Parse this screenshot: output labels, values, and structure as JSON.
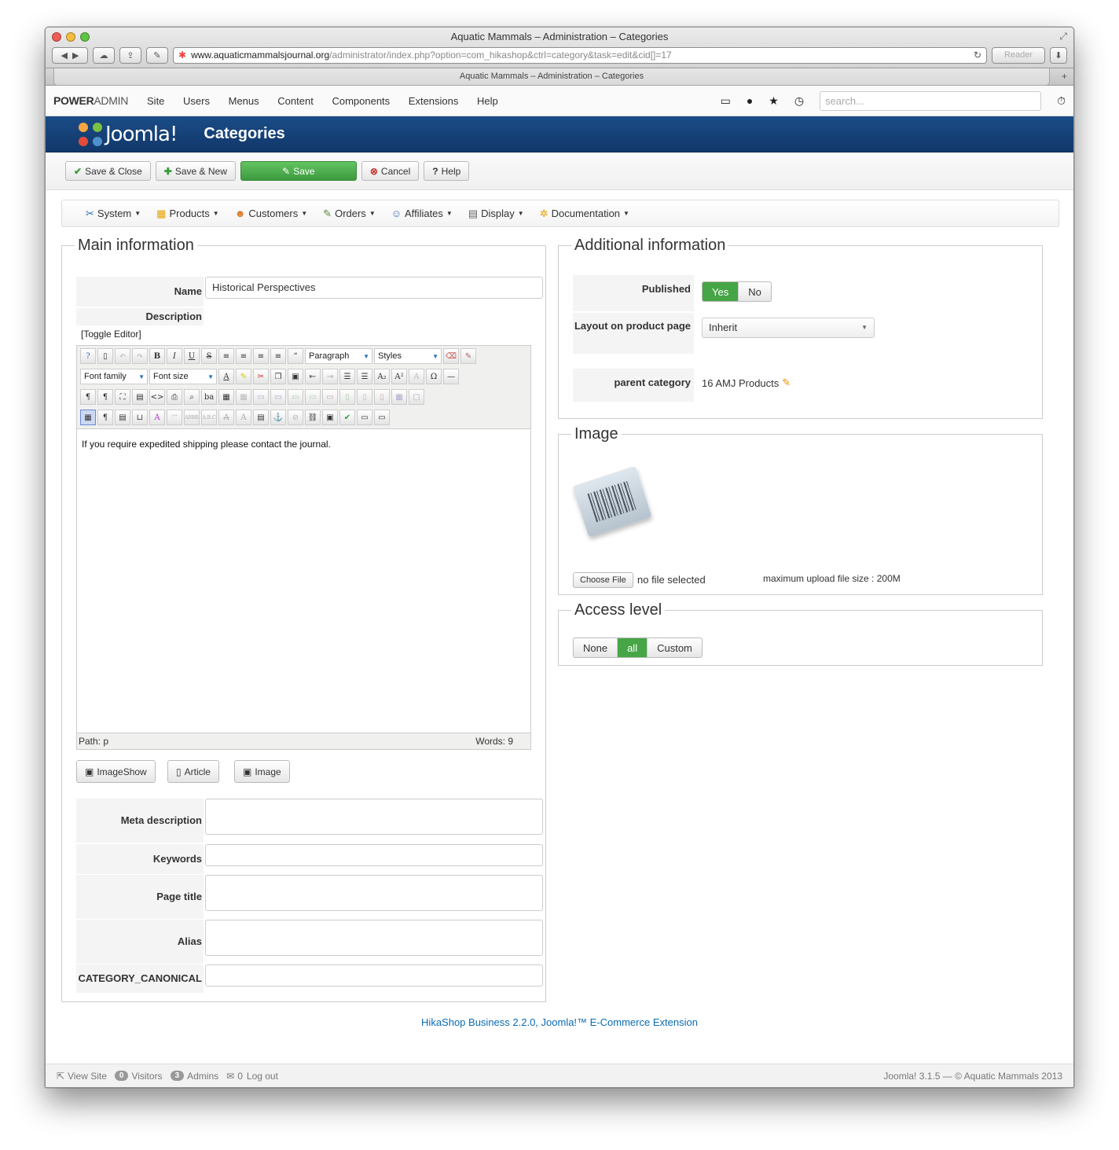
{
  "browser": {
    "window_title": "Aquatic Mammals – Administration – Categories",
    "tab_title": "Aquatic Mammals – Administration – Categories",
    "url_domain": "www.aquaticmammalsjournal.org",
    "url_path": "/administrator/index.php?option=com_hikashop&ctrl=category&task=edit&cid[]=17",
    "reader_label": "Reader"
  },
  "adminbar": {
    "brand_a": "POWER",
    "brand_b": "ADMIN",
    "menu": [
      "Site",
      "Users",
      "Menus",
      "Content",
      "Components",
      "Extensions",
      "Help"
    ],
    "search_placeholder": "search..."
  },
  "header": {
    "logo_text": "Joomla!",
    "title": "Categories"
  },
  "toolbar": {
    "save_close": "Save & Close",
    "save_new": "Save & New",
    "save": "Save",
    "cancel": "Cancel",
    "help": "Help"
  },
  "hikamenu": [
    "System",
    "Products",
    "Customers",
    "Orders",
    "Affiliates",
    "Display",
    "Documentation"
  ],
  "main": {
    "legend": "Main information",
    "name_label": "Name",
    "name_value": "Historical Perspectives",
    "description_label": "Description",
    "toggle_editor": "[Toggle Editor]",
    "paragraph": "Paragraph",
    "styles": "Styles",
    "font_family": "Font family",
    "font_size": "Font size",
    "editor_content": "If you require expedited shipping please contact the journal.",
    "path": "Path:  p",
    "words": "Words: 9",
    "btn_imageshow": "ImageShow",
    "btn_article": "Article",
    "btn_image": "Image",
    "meta_description_label": "Meta description",
    "keywords_label": "Keywords",
    "page_title_label": "Page title",
    "alias_label": "Alias",
    "canonical_label": "CATEGORY_CANONICAL"
  },
  "additional": {
    "legend": "Additional information",
    "published_label": "Published",
    "yes": "Yes",
    "no": "No",
    "layout_label": "Layout on product page",
    "layout_value": "Inherit",
    "parent_label": "parent category",
    "parent_value": "16 AMJ Products"
  },
  "image": {
    "legend": "Image",
    "choose_file": "Choose File",
    "no_file": "no file selected",
    "max_upload": "maximum upload file size : 200M"
  },
  "access": {
    "legend": "Access level",
    "options": [
      "None",
      "all",
      "Custom"
    ],
    "selected": "all"
  },
  "credit": "HikaShop Business 2.2.0, Joomla!™ E-Commerce Extension",
  "footer": {
    "view_site": "View Site",
    "visitors_count": "0",
    "visitors": "Visitors",
    "admins_count": "3",
    "admins": "Admins",
    "messages_count": "0",
    "logout": "Log out",
    "version": "Joomla! 3.1.5  —  © Aquatic Mammals 2013"
  },
  "colors": {
    "header_blue": "#164276",
    "success_green": "#46a546",
    "link_blue": "#0a6bb5"
  }
}
